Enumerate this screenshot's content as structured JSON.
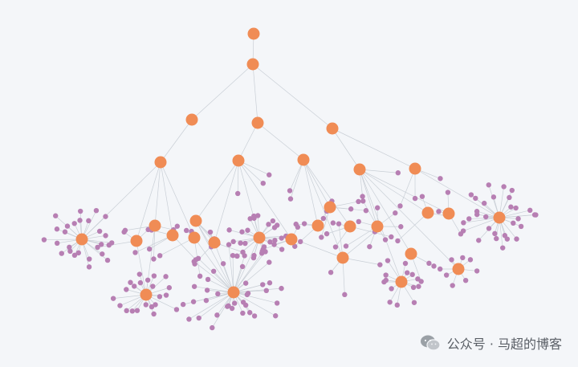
{
  "colors": {
    "background": "#f4f6f9",
    "hub_node": "#f08c55",
    "leaf_node": "#b77fb3",
    "edge": "#c9cfd6"
  },
  "watermark": {
    "icon": "wechat-icon",
    "text": "公众号 · 马超的博客"
  }
}
